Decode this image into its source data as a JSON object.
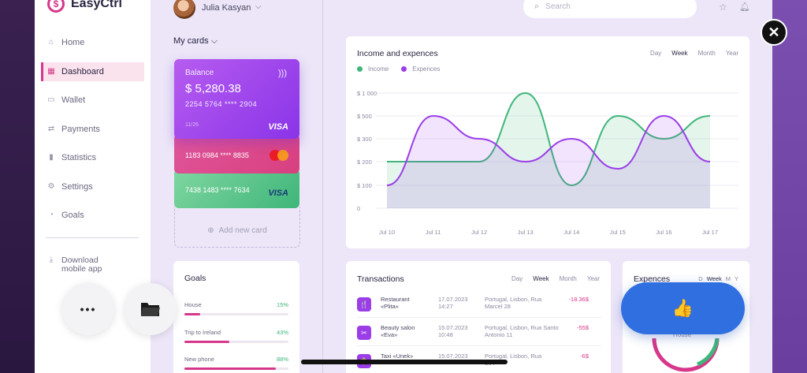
{
  "app": {
    "name": "EasyCtrl",
    "logo_symbol": "$"
  },
  "sidebar": {
    "items": [
      {
        "label": "Home",
        "icon": "home-icon"
      },
      {
        "label": "Dashboard",
        "icon": "grid-icon",
        "active": true
      },
      {
        "label": "Wallet",
        "icon": "wallet-icon"
      },
      {
        "label": "Payments",
        "icon": "swap-icon"
      },
      {
        "label": "Statistics",
        "icon": "bar-chart-icon"
      },
      {
        "label": "Settings",
        "icon": "gear-icon"
      },
      {
        "label": "Goals",
        "icon": "pie-icon"
      }
    ],
    "download_line1": "Download",
    "download_line2": "mobile app"
  },
  "header": {
    "user_name": "Julia  Kasyan",
    "search_placeholder": "Search"
  },
  "cards": {
    "section_title": "My cards",
    "balance_label": "Balance",
    "balance_amount": "$ 5,280.38",
    "balance_number": "2254  5764  ****  2904",
    "balance_expiry": "11/26",
    "balance_brand": "VISA",
    "pink_number": "1183  0984  ****  8835",
    "green_number": "7438  1483  ****  7634",
    "green_brand": "VISA",
    "add_label": "Add new card"
  },
  "chart_panel": {
    "title": "Income and expences",
    "periods": [
      "Day",
      "Week",
      "Month",
      "Year"
    ],
    "selected_period": "Week"
  },
  "chart_data": {
    "type": "area",
    "x": [
      "Jul 10",
      "Jul 11",
      "Jul 12",
      "Jul 13",
      "Jul 14",
      "Jul 15",
      "Jul 16",
      "Jul 17"
    ],
    "y_ticks": [
      "$ 1 000",
      "$ 500",
      "$ 300",
      "$ 200",
      "$ 100",
      "0"
    ],
    "series": [
      {
        "name": "Income",
        "color": "#3fb67a",
        "values": [
          200,
          200,
          200,
          1000,
          100,
          500,
          300,
          500
        ]
      },
      {
        "name": "Expences",
        "color": "#9b3ee8",
        "values": [
          100,
          500,
          300,
          200,
          300,
          170,
          500,
          200
        ]
      }
    ],
    "grid": true,
    "legend": "top-left"
  },
  "goals": {
    "title": "Goals",
    "items": [
      {
        "label": "House",
        "pct_label": "15%",
        "progress": 0.15
      },
      {
        "label": "Trip to Ireland",
        "pct_label": "43%",
        "progress": 0.43
      },
      {
        "label": "New phone",
        "pct_label": "88%",
        "progress": 0.88
      }
    ]
  },
  "transactions": {
    "title": "Transactions",
    "periods": [
      "Day",
      "Week",
      "Month",
      "Year"
    ],
    "selected_period": "Week",
    "rows": [
      {
        "icon": "fork-knife-icon",
        "glyph": "🍴",
        "name1": "Restaurant",
        "name2": "«Plita»",
        "date": "17.07.2023",
        "time": "14:27",
        "loc1": "Portugal, Lisbon, Rua",
        "loc2": "Marcel 28",
        "amount": "-18.36$"
      },
      {
        "icon": "scissors-icon",
        "glyph": "✂",
        "name1": "Beauty salon",
        "name2": "«Eva»",
        "date": "15.07.2023",
        "time": "10:48",
        "loc1": "Portugal, Lisbon, Rua Santo",
        "loc2": "Antonio 11",
        "amount": "-55$"
      },
      {
        "icon": "taxi-icon",
        "glyph": "🚖",
        "name1": "Taxi «Unek»",
        "name2": "",
        "date": "15.07.2023",
        "time": "",
        "loc1": "Portugal, Lisbon, Rua",
        "loc2": "BIA",
        "amount": "-6$"
      }
    ]
  },
  "expenses": {
    "title": "Expences",
    "periods": [
      "D",
      "Week",
      "M",
      "Y"
    ],
    "selected_period": "Week",
    "center_label": "House",
    "colors": {
      "a": "#d6378a",
      "b": "#3fb67a"
    }
  },
  "overlay": {
    "close_symbol": "✕",
    "more_symbol": "•••",
    "like_symbol": "👍"
  }
}
